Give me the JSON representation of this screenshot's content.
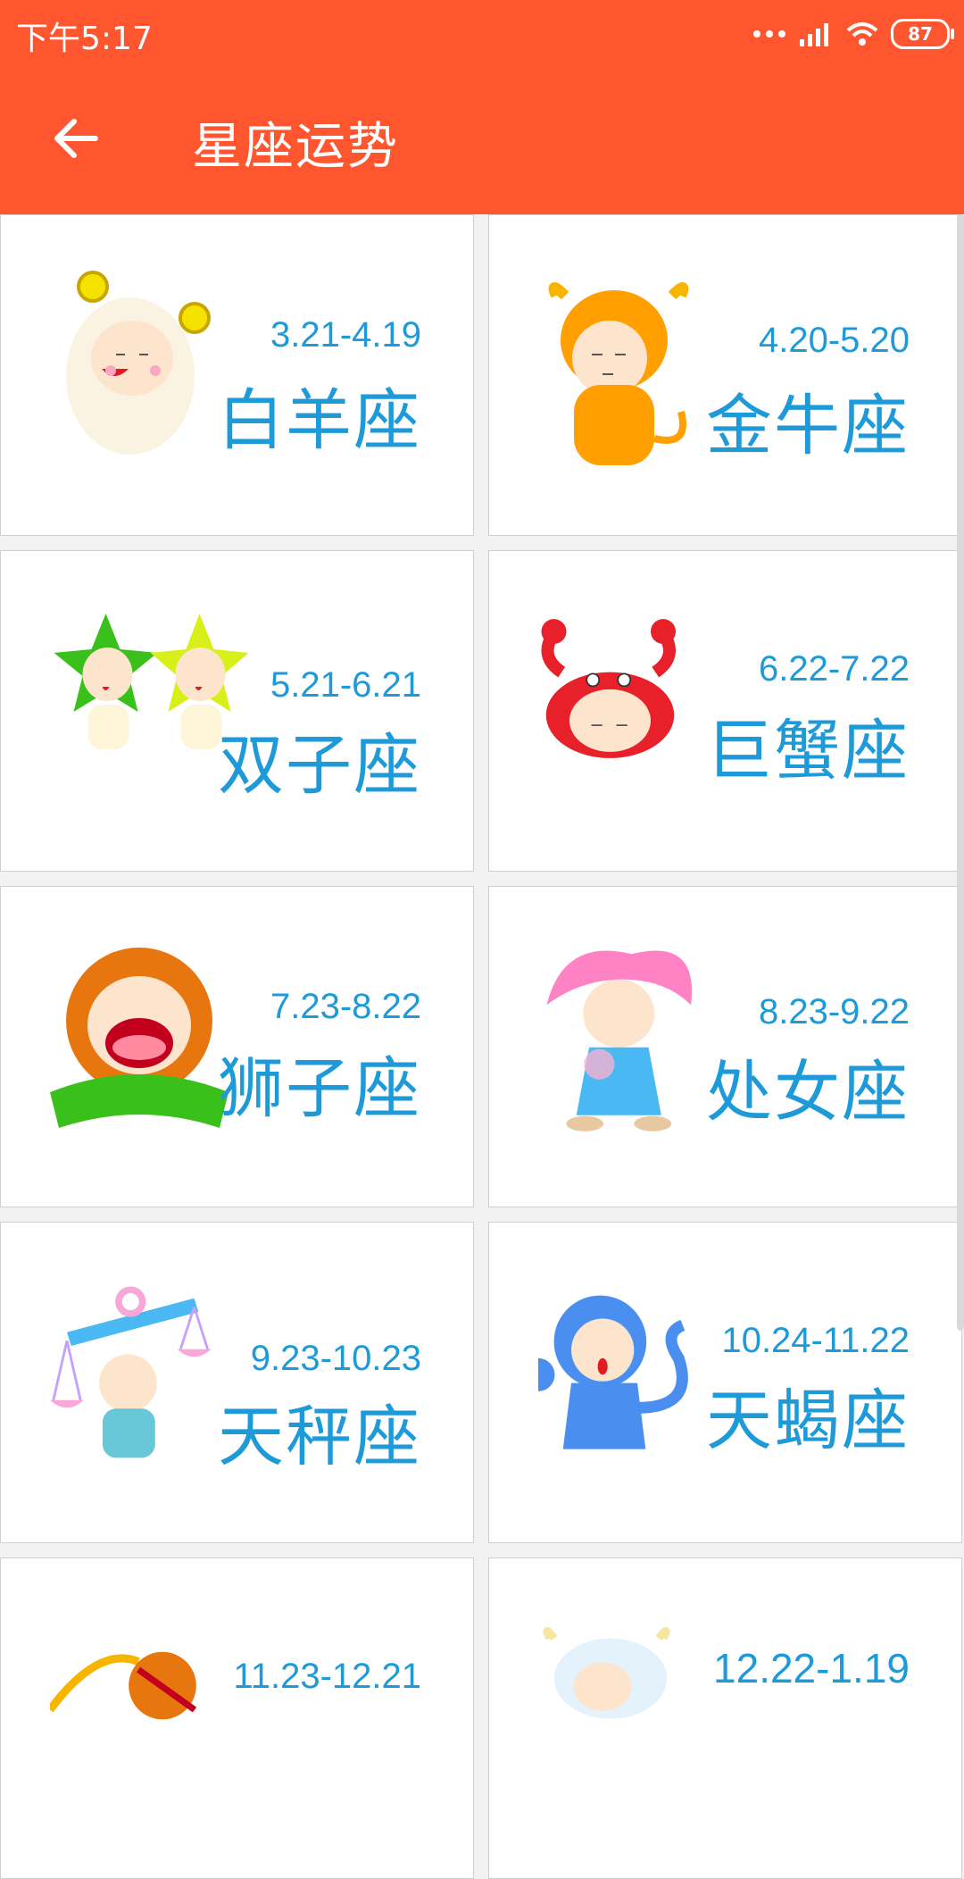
{
  "status": {
    "time": "下午5:17",
    "battery": "87"
  },
  "appbar": {
    "title": "星座运势"
  },
  "signs": [
    {
      "date": "3.21-4.19",
      "name": "白羊座"
    },
    {
      "date": "4.20-5.20",
      "name": "金牛座"
    },
    {
      "date": "5.21-6.21",
      "name": "双子座"
    },
    {
      "date": "6.22-7.22",
      "name": "巨蟹座"
    },
    {
      "date": "7.23-8.22",
      "name": "狮子座"
    },
    {
      "date": "8.23-9.22",
      "name": "处女座"
    },
    {
      "date": "9.23-10.23",
      "name": "天秤座"
    },
    {
      "date": "10.24-11.22",
      "name": "天蝎座"
    },
    {
      "date": "11.23-12.21",
      "name": ""
    },
    {
      "date": "12.22-1.19",
      "name": ""
    }
  ],
  "colors": {
    "primary": "#ff5630",
    "accent": "#1e9ad9"
  }
}
